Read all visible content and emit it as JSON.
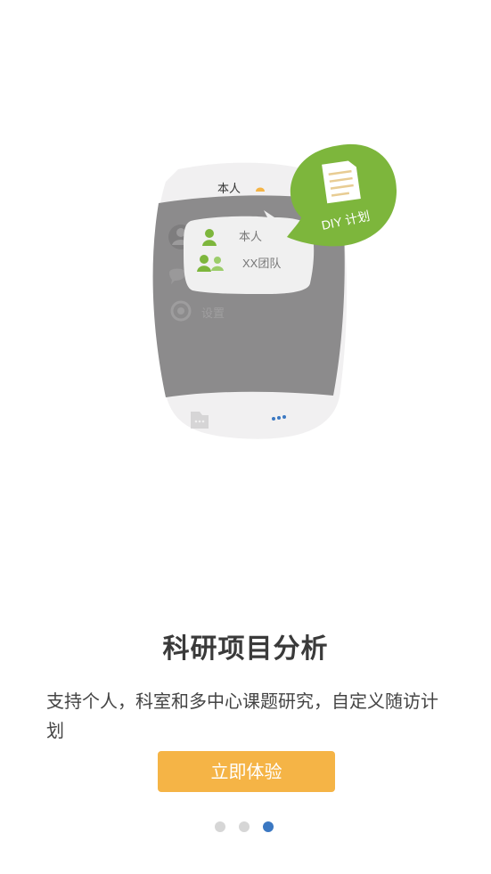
{
  "illustration": {
    "header_label": "本人",
    "menu_item_self": "本人",
    "menu_item_team": "XX团队",
    "settings_label": "设置",
    "badge_label": "DIY 计划"
  },
  "title": "科研项目分析",
  "description": "支持个人，科室和多中心课题研究，自定义随访计划",
  "cta_label": "立即体验",
  "pager": {
    "total": 3,
    "active_index": 2
  },
  "colors": {
    "accent_orange": "#f5b446",
    "brand_green": "#7db63c",
    "active_dot": "#3b78c2",
    "inactive_dot": "#d6d6d6"
  }
}
